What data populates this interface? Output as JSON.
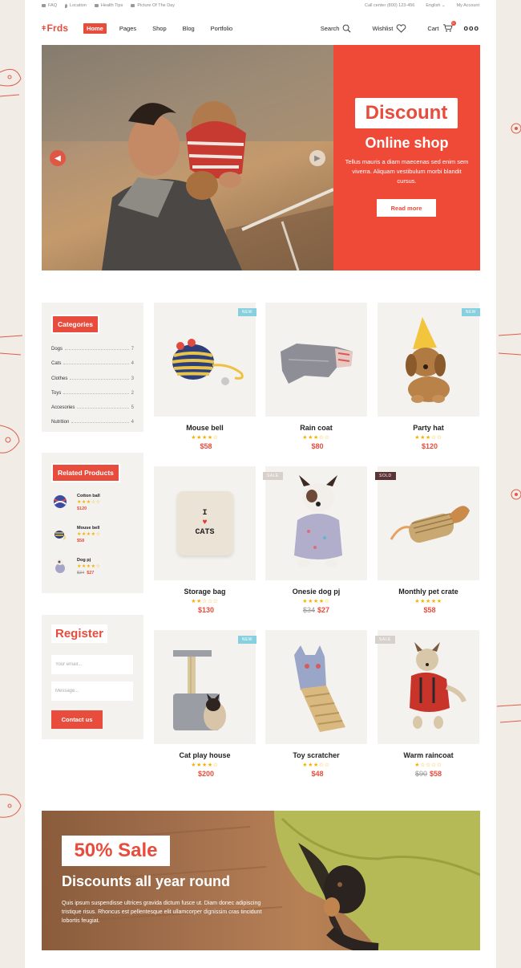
{
  "topbar": {
    "faq": "FAQ",
    "location": "Location",
    "health": "Health Tips",
    "picture": "Picture Of The Day",
    "callcenter": "Call center (800) 123-456",
    "language": "English ⌄",
    "account": "My Account"
  },
  "header": {
    "logo": "Frds",
    "nav": [
      "Home",
      "Pages",
      "Shop",
      "Blog",
      "Portfolio"
    ],
    "search": "Search",
    "wishlist": "Wishlist",
    "cart": "Cart",
    "cart_count": "0",
    "more": "ooo"
  },
  "hero": {
    "title": "Discount",
    "subtitle": "Online shop",
    "description": "Tellus mauris a diam maecenas sed enim sem viverra. Aliquam vestibulum morbi blandit cursus.",
    "button": "Read more"
  },
  "categories": {
    "title": "Categories",
    "items": [
      {
        "name": "Dogs",
        "count": "7"
      },
      {
        "name": "Cats",
        "count": "4"
      },
      {
        "name": "Clothes",
        "count": "3"
      },
      {
        "name": "Toys",
        "count": "2"
      },
      {
        "name": "Accesories",
        "count": "5"
      },
      {
        "name": "Nutrition",
        "count": "4"
      }
    ]
  },
  "related": {
    "title": "Related Products",
    "items": [
      {
        "name": "Cotton ball",
        "stars": "★★★☆☆",
        "old_price": "",
        "price": "$120"
      },
      {
        "name": "Mouse bell",
        "stars": "★★★★☆",
        "old_price": "",
        "price": "$58"
      },
      {
        "name": "Dog pj",
        "stars": "★★★★☆",
        "old_price": "$34",
        "price": "$27"
      }
    ]
  },
  "register": {
    "title": "Register",
    "email_placeholder": "Your email...",
    "message_placeholder": "Message...",
    "button": "Contact us"
  },
  "products": [
    {
      "name": "Mouse bell",
      "stars": "★★★★☆",
      "old_price": "",
      "price": "$58",
      "badge": "NEW"
    },
    {
      "name": "Rain coat",
      "stars": "★★★☆☆",
      "old_price": "",
      "price": "$80",
      "badge": ""
    },
    {
      "name": "Party hat",
      "stars": "★★★☆☆",
      "old_price": "",
      "price": "$120",
      "badge": "NEW"
    },
    {
      "name": "Storage bag",
      "stars": "★★☆☆☆",
      "old_price": "",
      "price": "$130",
      "badge": ""
    },
    {
      "name": "Onesie dog pj",
      "stars": "★★★★☆",
      "old_price": "$34",
      "price": "$27",
      "badge": "SALE"
    },
    {
      "name": "Monthly pet crate",
      "stars": "★★★★★",
      "old_price": "",
      "price": "$58",
      "badge": "SOLD"
    },
    {
      "name": "Cat play house",
      "stars": "★★★★☆",
      "old_price": "",
      "price": "$200",
      "badge": "NEW"
    },
    {
      "name": "Toy scratcher",
      "stars": "★★★☆☆",
      "old_price": "",
      "price": "$48",
      "badge": ""
    },
    {
      "name": "Warm raincoat",
      "stars": "★☆☆☆☆",
      "old_price": "$90",
      "price": "$58",
      "badge": "SALE"
    }
  ],
  "storage_bag_print": {
    "line1": "I",
    "line2": "CATS"
  },
  "sale": {
    "badge": "50% Sale",
    "title": "Discounts all year round",
    "description": "Quis ipsum suspendisse ultrices gravida dictum fusce ut. Diam donec adipiscing tristique risus. Rhoncus est pellentesque elit ullamcorper dignissim cras tincidunt lobortis feugiat."
  },
  "colors": {
    "accent": "#e74c3c",
    "star": "#f5b301",
    "new_badge": "#86d0df",
    "sold_badge": "#5b3436"
  }
}
